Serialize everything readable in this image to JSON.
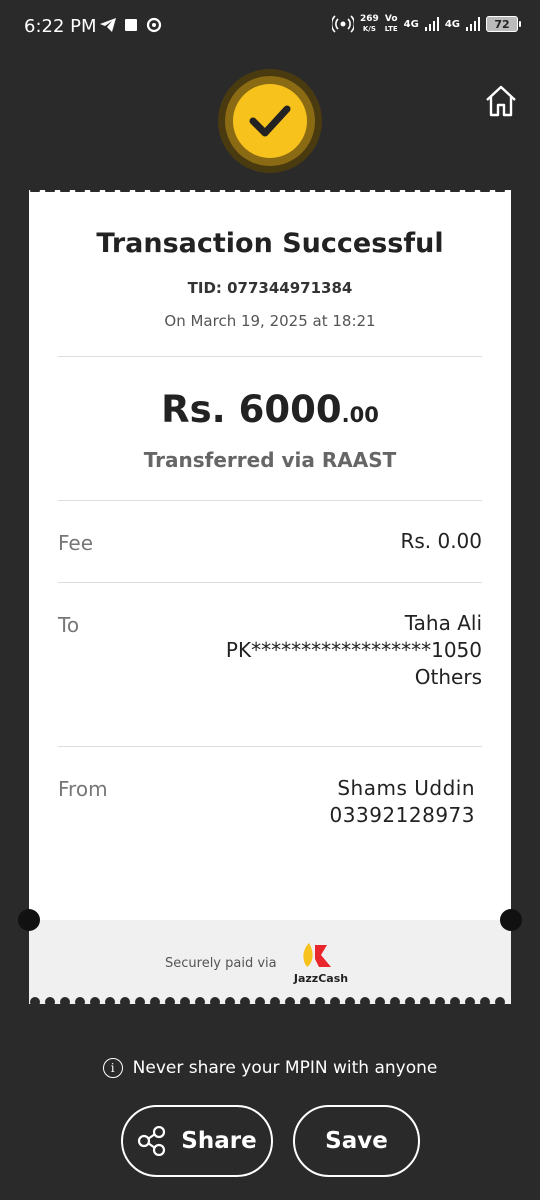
{
  "status_bar": {
    "time": "6:22 PM",
    "net_speed": "269",
    "net_unit": "K/S",
    "volte_top": "Vo",
    "volte_bottom": "LTE",
    "signal1": "4G",
    "signal2": "4G",
    "battery": "72"
  },
  "receipt": {
    "title": "Transaction Successful",
    "tid": "TID: 077344971384",
    "date": "On March 19, 2025 at 18:21",
    "amount_main": "Rs. 6000",
    "amount_decimal": ".00",
    "method": "Transferred via RAAST",
    "fee_label": "Fee",
    "fee_value": "Rs. 0.00",
    "to_label": "To",
    "to_name": "Taha Ali",
    "to_account": "PK******************1050",
    "to_bank": "Others",
    "from_label": "From",
    "from_name": "Shams Uddin",
    "from_number": "03392128973",
    "secure_text": "Securely paid via",
    "brand": "JazzCash"
  },
  "warning": "Never share your MPIN with anyone",
  "actions": {
    "share": "Share",
    "save": "Save"
  },
  "colors": {
    "accent": "#f7c21c",
    "background": "#2a2a2a",
    "jazzcash_red": "#e8262b",
    "jazzcash_yellow": "#f7c21c"
  },
  "icons": [
    "home-icon",
    "check-icon",
    "info-icon",
    "share-icon",
    "telegram-icon",
    "sync-icon"
  ]
}
